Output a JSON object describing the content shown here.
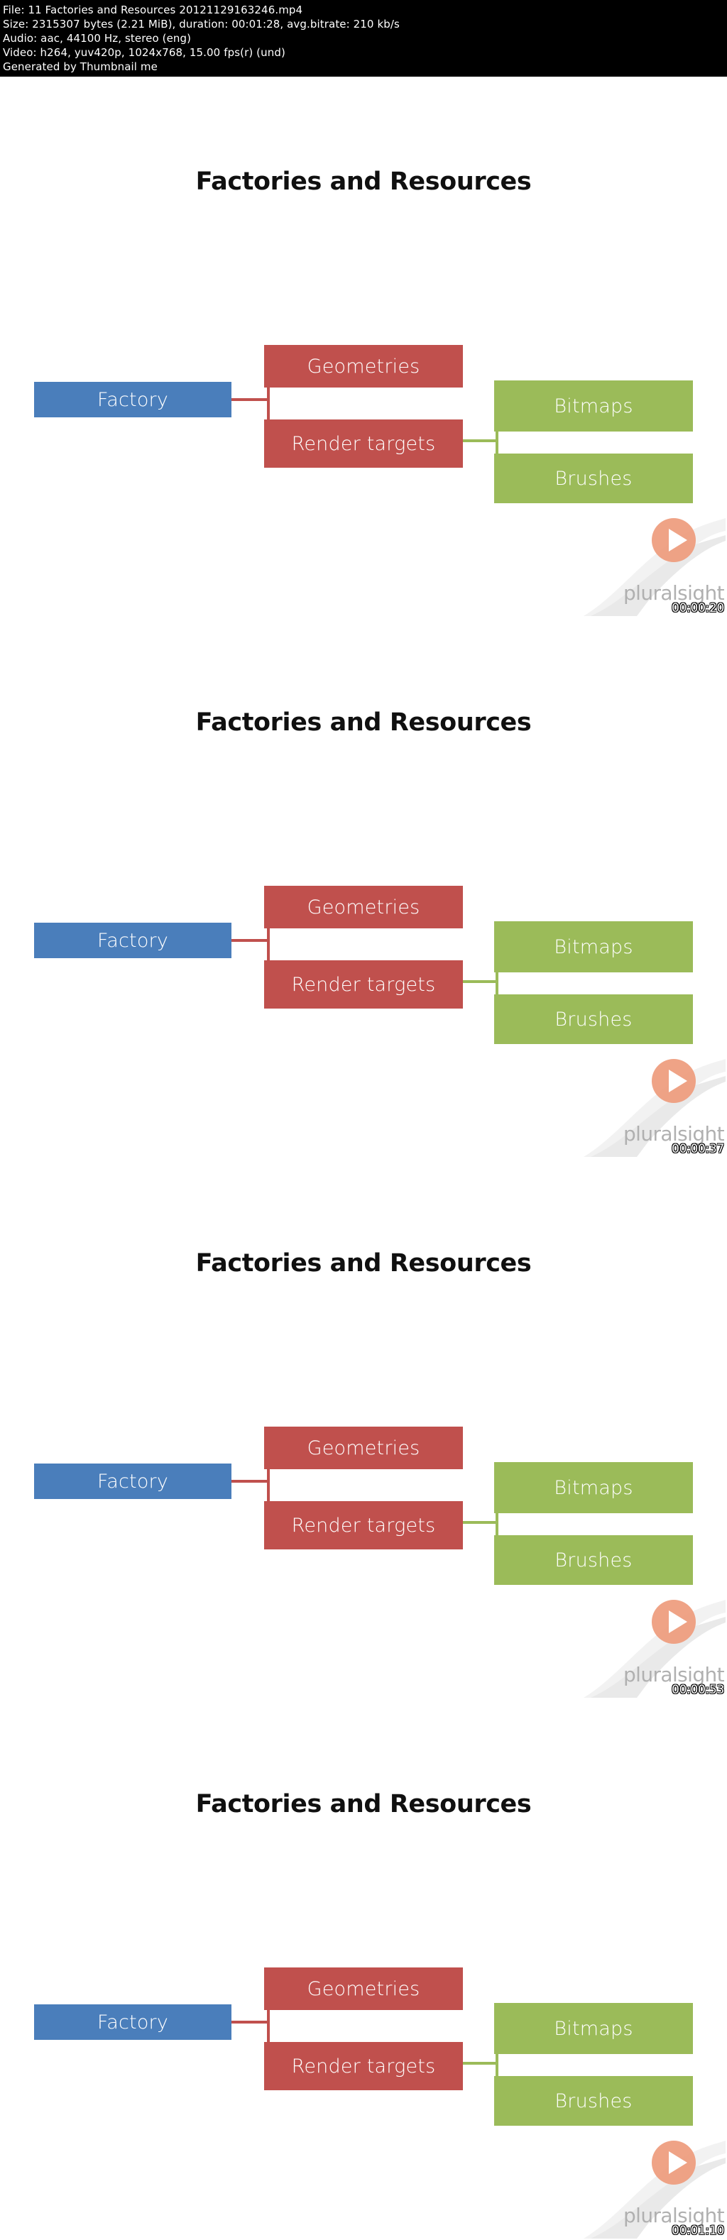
{
  "info_header": {
    "lines": [
      "File: 11 Factories and Resources 20121129163246.mp4",
      "Size: 2315307 bytes (2.21 MiB), duration: 00:01:28, avg.bitrate: 210 kb/s",
      "Audio: aac, 44100 Hz, stereo (eng)",
      "Video: h264, yuv420p, 1024x768, 15.00 fps(r) (und)",
      "Generated by Thumbnail me"
    ]
  },
  "colors": {
    "factory_blue": "#4a7ebb",
    "resource_red": "#c0504d",
    "resource_green": "#9bbb59",
    "play_orange": "#ee9b7c",
    "wordmark_gray": "#b0b0b0",
    "header_background": "#000000",
    "slide_background": "#ffffff"
  },
  "watermark": {
    "wordmark": "pluralsight",
    "play_icon": "play-triangle-icon"
  },
  "slide": {
    "title": "Factories and Resources",
    "nodes": {
      "factory": "Factory",
      "geometries": "Geometries",
      "render_targets": "Render targets",
      "bitmaps": "Bitmaps",
      "brushes": "Brushes"
    }
  },
  "frames": [
    {
      "index": 1,
      "timestamp": "00:00:20",
      "title": "Factories and Resources"
    },
    {
      "index": 2,
      "timestamp": "00:00:37",
      "title": "Factories and Resources"
    },
    {
      "index": 3,
      "timestamp": "00:00:53",
      "title": "Factories and Resources"
    },
    {
      "index": 4,
      "timestamp": "00:01:10",
      "title": "Factories and Resources"
    }
  ]
}
